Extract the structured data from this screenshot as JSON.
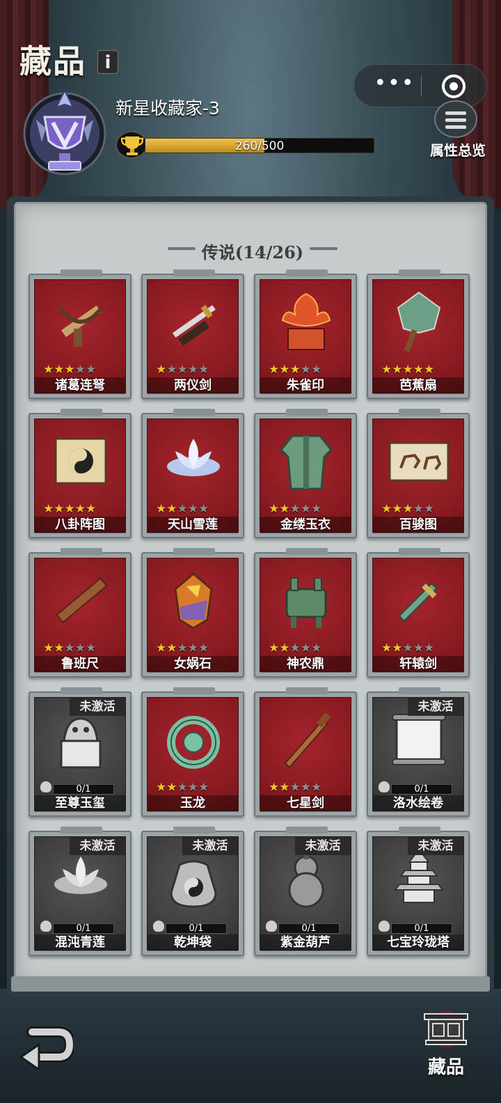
{
  "header": {
    "title": "藏品",
    "info_icon": "i",
    "capsule_dots": "•••",
    "rank_name": "新星收藏家-3",
    "progress_text": "260/500",
    "progress_value": 260,
    "progress_max": 500,
    "attr_label": "属性总览"
  },
  "section": {
    "title": "传说(14/26)"
  },
  "items": [
    {
      "name": "诸葛连弩",
      "stars": 3,
      "locked": false,
      "icon": "crossbow-icon"
    },
    {
      "name": "两仪剑",
      "stars": 1,
      "locked": false,
      "icon": "sword-icon"
    },
    {
      "name": "朱雀印",
      "stars": 3,
      "locked": false,
      "icon": "phoenix-seal-icon"
    },
    {
      "name": "芭蕉扇",
      "stars": 5,
      "locked": false,
      "icon": "fan-icon"
    },
    {
      "name": "八卦阵图",
      "stars": 5,
      "locked": false,
      "icon": "bagua-scroll-icon"
    },
    {
      "name": "天山雪莲",
      "stars": 2,
      "locked": false,
      "icon": "lotus-icon"
    },
    {
      "name": "金缕玉衣",
      "stars": 2,
      "locked": false,
      "icon": "jade-armor-icon"
    },
    {
      "name": "百骏图",
      "stars": 3,
      "locked": false,
      "icon": "horse-painting-icon"
    },
    {
      "name": "鲁班尺",
      "stars": 2,
      "locked": false,
      "icon": "ruler-icon"
    },
    {
      "name": "女娲石",
      "stars": 2,
      "locked": false,
      "icon": "gem-stone-icon"
    },
    {
      "name": "神农鼎",
      "stars": 2,
      "locked": false,
      "icon": "cauldron-icon"
    },
    {
      "name": "轩辕剑",
      "stars": 2,
      "locked": false,
      "icon": "jade-sword-icon"
    },
    {
      "name": "至尊玉玺",
      "stars": 0,
      "locked": true,
      "locked_label": "未激活",
      "fragments": "0/1",
      "icon": "dragon-seal-icon"
    },
    {
      "name": "玉龙",
      "stars": 2,
      "locked": false,
      "icon": "jade-dragon-icon"
    },
    {
      "name": "七星剑",
      "stars": 2,
      "locked": false,
      "icon": "bronze-sword-icon"
    },
    {
      "name": "洛水绘卷",
      "stars": 0,
      "locked": true,
      "locked_label": "未激活",
      "fragments": "0/1",
      "icon": "scroll-icon"
    },
    {
      "name": "混沌青莲",
      "stars": 0,
      "locked": true,
      "locked_label": "未激活",
      "fragments": "0/1",
      "icon": "lotus-icon"
    },
    {
      "name": "乾坤袋",
      "stars": 0,
      "locked": true,
      "locked_label": "未激活",
      "fragments": "0/1",
      "icon": "bag-icon"
    },
    {
      "name": "紫金葫芦",
      "stars": 0,
      "locked": true,
      "locked_label": "未激活",
      "fragments": "0/1",
      "icon": "gourd-icon"
    },
    {
      "name": "七宝玲珑塔",
      "stars": 0,
      "locked": true,
      "locked_label": "未激活",
      "fragments": "0/1",
      "icon": "pagoda-icon"
    }
  ],
  "bottom": {
    "collection_label": "藏品"
  },
  "colors": {
    "card_red": "#861a20",
    "card_locked": "#3d3d3d",
    "star_on": "#f6c326",
    "star_off": "#8d8d8d",
    "progress_fill": "#e0aa35"
  }
}
